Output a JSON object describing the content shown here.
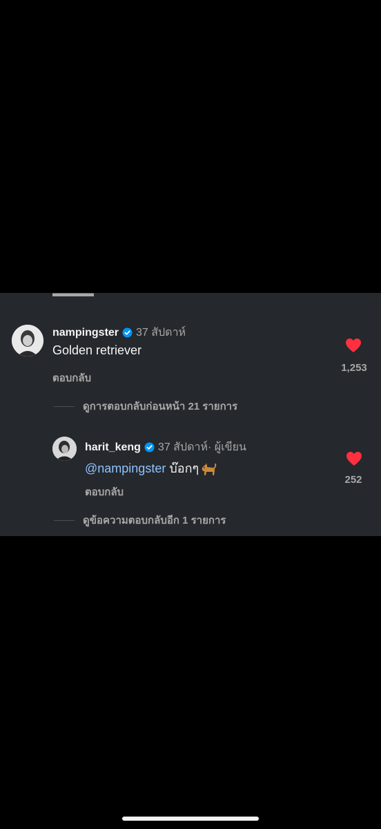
{
  "comment": {
    "username": "nampingster",
    "time": "37 สัปดาห์",
    "text": "Golden retriever",
    "reply_label": "ตอบกลับ",
    "likes": "1,253",
    "view_previous_replies": "ดูการตอบกลับก่อนหน้า 21 รายการ"
  },
  "reply": {
    "username": "harit_keng",
    "time": "37 สัปดาห์",
    "author_tag": " · ผู้เขียน",
    "mention": "@nampingster",
    "text": " บ๊อกๆ",
    "reply_label": "ตอบกลับ",
    "likes": "252"
  },
  "view_more_replies": "ดูข้อความตอบกลับอีก 1 รายการ",
  "colors": {
    "panel_background": "#25282c",
    "like_red": "#ff3040",
    "verified_blue": "#0095f6",
    "mention_blue": "#8fc3ff"
  },
  "icons": {
    "verified": "verified-badge-icon",
    "like": "heart-icon",
    "emoji": "dog-emoji"
  }
}
